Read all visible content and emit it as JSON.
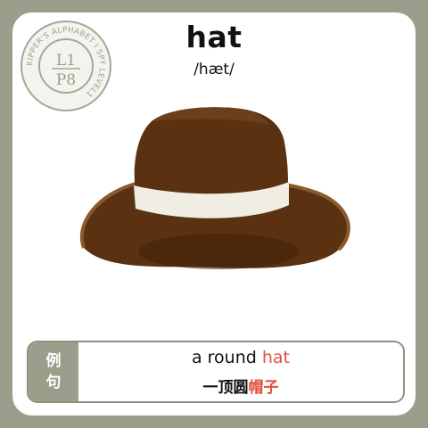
{
  "word": "hat",
  "phonetic": "/hæt/",
  "stamp": {
    "ring_text": "KIPPER'S ALPHABET I SPY LEVEL1",
    "level": "L1",
    "page": "P8"
  },
  "example": {
    "tag_line1": "例",
    "tag_line2": "句",
    "en_prefix": "a round ",
    "en_word": "hat",
    "zh_prefix": "一顶圆",
    "zh_word": "帽子"
  },
  "colors": {
    "background": "#9c9e8c",
    "card": "#ffffff",
    "highlight": "#e0503a",
    "hat_brown": "#5a3212",
    "hat_band": "#f0ede2"
  }
}
